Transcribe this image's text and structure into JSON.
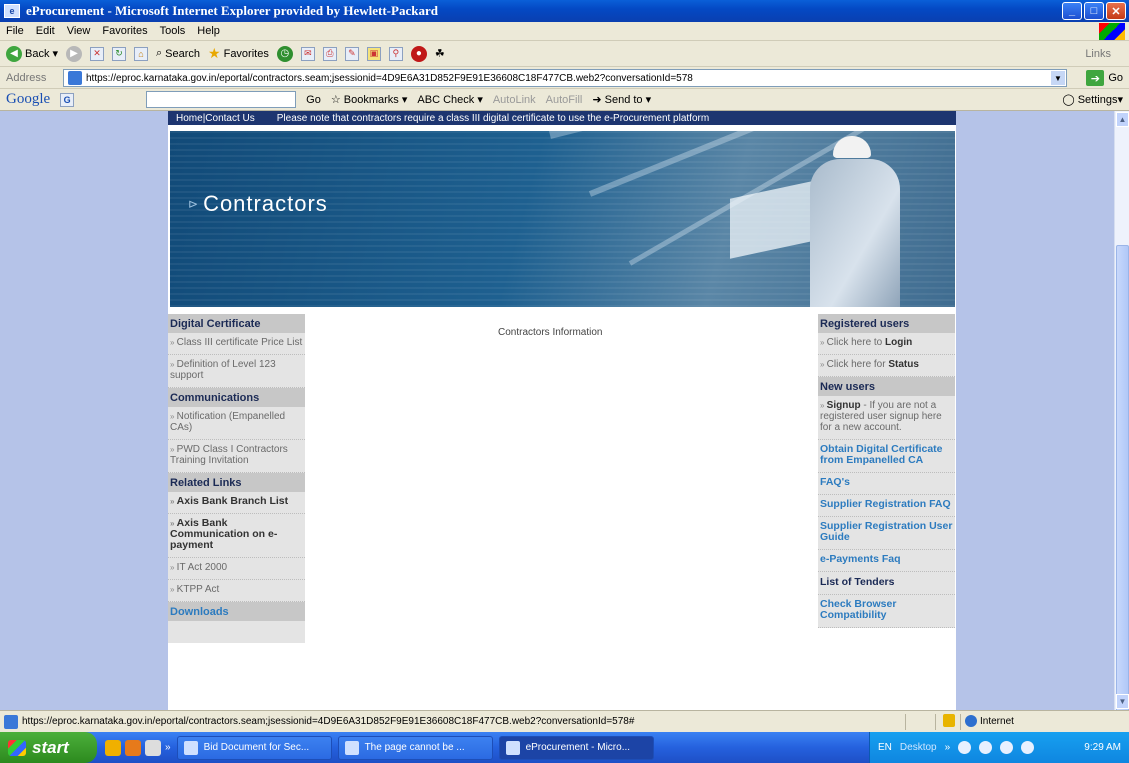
{
  "window": {
    "title": "eProcurement - Microsoft Internet Explorer provided by Hewlett-Packard"
  },
  "menu": [
    "File",
    "Edit",
    "View",
    "Favorites",
    "Tools",
    "Help"
  ],
  "toolbar": {
    "back": "Back",
    "search": "Search",
    "favorites": "Favorites",
    "links": "Links"
  },
  "address": {
    "label": "Address",
    "url": "https://eproc.karnataka.gov.in/eportal/contractors.seam;jsessionid=4D9E6A31D852F9E91E36608C18F477CB.web2?conversationId=578",
    "go": "Go"
  },
  "google": {
    "logo": "Google",
    "go": "Go",
    "bookmarks": "Bookmarks",
    "check": "Check",
    "autolink": "AutoLink",
    "autofill": "AutoFill",
    "sendto": "Send to",
    "settings": "Settings"
  },
  "page": {
    "topnav": {
      "home": "Home",
      "contact": "|Contact Us",
      "notice": "Please note that contractors require a class III digital certificate to use the e-Procurement platform"
    },
    "banner_title": "Contractors",
    "center_text": "Contractors Information",
    "left": {
      "digital_certificate": {
        "heading": "Digital Certificate",
        "items": [
          "Class III certificate Price List",
          "Definition of Level 123 support"
        ]
      },
      "communications": {
        "heading": "Communications",
        "items": [
          "Notification (Empanelled CAs)",
          "PWD Class I Contractors Training Invitation"
        ]
      },
      "related_links": {
        "heading": "Related Links",
        "items": [
          "Axis Bank Branch List",
          "Axis Bank Communication on e-payment",
          "IT Act 2000",
          "KTPP Act"
        ]
      },
      "downloads": "Downloads"
    },
    "right": {
      "registered_heading": "Registered users",
      "login": {
        "prefix": "Click here to ",
        "bold": "Login"
      },
      "status": {
        "prefix": "Click here for ",
        "bold": "Status"
      },
      "new_users_heading": "New users",
      "signup": {
        "bold": "Signup",
        "text": " - If you are not a registered user signup here for a new account."
      },
      "links": [
        "Obtain Digital Certificate from Empanelled CA",
        "FAQ's",
        "Supplier Registration FAQ",
        "Supplier Registration User Guide",
        "e-Payments Faq"
      ],
      "list_of_tenders": "List of Tenders",
      "check_browser": "Check Browser Compatibility"
    }
  },
  "status": {
    "url": "https://eproc.karnataka.gov.in/eportal/contractors.seam;jsessionid=4D9E6A31D852F9E91E36608C18F477CB.web2?conversationId=578#",
    "zone": "Internet"
  },
  "taskbar": {
    "start": "start",
    "tasks": [
      "Bid Document for Sec...",
      "The page cannot be ...",
      "eProcurement - Micro..."
    ],
    "lang": "EN",
    "desktop": "Desktop",
    "clock": "9:29 AM"
  }
}
